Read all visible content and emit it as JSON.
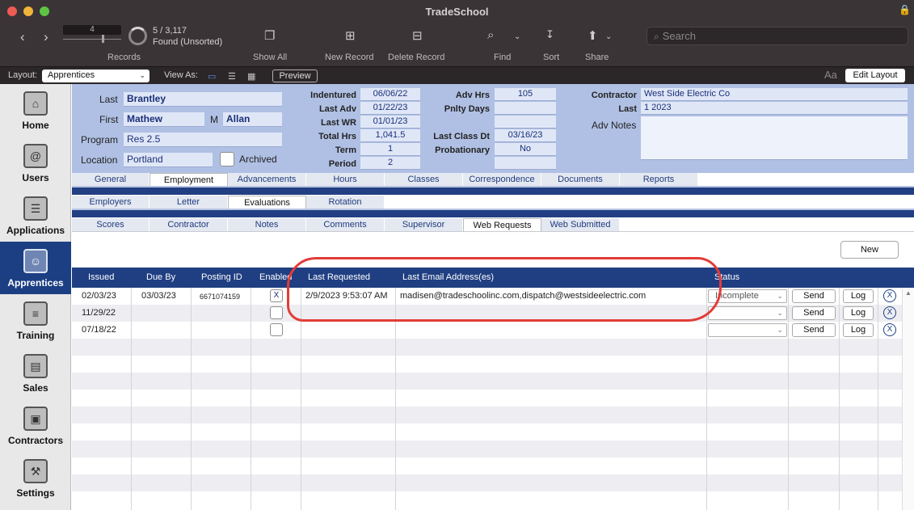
{
  "window": {
    "title": "TradeSchool",
    "colors": {
      "titlebar": "#3a3436",
      "sidebar_active": "#1c3f83",
      "header_bg": "#b0c0e4",
      "stripe": "#223f83",
      "annotation": "#e23c37"
    }
  },
  "toolbar": {
    "record_number": "4",
    "record_count": "5 / 3,117",
    "found_status": "Found (Unsorted)",
    "records_label": "Records",
    "show_all": "Show All",
    "new_record": "New Record",
    "delete_record": "Delete Record",
    "find": "Find",
    "sort": "Sort",
    "share": "Share",
    "search_placeholder": "Search"
  },
  "layoutbar": {
    "layout_label": "Layout:",
    "layout_value": "Apprentices",
    "view_as_label": "View As:",
    "preview": "Preview",
    "aa": "Aa",
    "edit_layout": "Edit Layout"
  },
  "sidebar": {
    "items": [
      {
        "label": "Home",
        "icon": "house-icon"
      },
      {
        "label": "Users",
        "icon": "address-book-icon"
      },
      {
        "label": "Applications",
        "icon": "clipboard-icon"
      },
      {
        "label": "Apprentices",
        "icon": "id-card-icon"
      },
      {
        "label": "Training",
        "icon": "certificate-icon"
      },
      {
        "label": "Sales",
        "icon": "cash-register-icon"
      },
      {
        "label": "Contractors",
        "icon": "briefcase-icon"
      },
      {
        "label": "Settings",
        "icon": "wrench-icon"
      }
    ]
  },
  "header": {
    "last_label": "Last",
    "last_value": "Brantley",
    "first_label": "First",
    "first_value": "Mathew",
    "middle_label": "M",
    "middle_value": "Allan",
    "program_label": "Program",
    "program_value": "Res 2.5",
    "location_label": "Location",
    "location_value": "Portland",
    "archived_label": "Archived",
    "indentured_label": "Indentured",
    "indentured_value": "06/06/22",
    "last_adv_label": "Last Adv",
    "last_adv_value": "01/22/23",
    "last_wr_label": "Last WR",
    "last_wr_value": "01/01/23",
    "total_hrs_label": "Total Hrs",
    "total_hrs_value": "1,041.5",
    "term_label": "Term",
    "term_value": "1",
    "period_label": "Period",
    "period_value": "2",
    "adv_hrs_label": "Adv Hrs",
    "adv_hrs_value": "105",
    "pnlty_days_label": "Pnlty Days",
    "pnlty_days_value": "",
    "last_class_label": "Last Class Dt",
    "last_class_value": "03/16/23",
    "probationary_label": "Probationary",
    "probationary_value": "No",
    "contractor_label": "Contractor",
    "contractor_value": "West Side Electric Co",
    "contractor_last_label": "Last",
    "contractor_last_value": "1 2023",
    "adv_notes_label": "Adv Notes"
  },
  "tabs": {
    "row1": [
      "General",
      "Employment",
      "Advancements",
      "Hours",
      "Classes",
      "Correspondence",
      "Documents",
      "Reports"
    ],
    "row2": [
      "Employers",
      "Letter",
      "Evaluations",
      "Rotation"
    ],
    "row3": [
      "Scores",
      "Contractor",
      "Notes",
      "Comments",
      "Supervisor",
      "Web Requests",
      "Web Submitted"
    ]
  },
  "portal": {
    "new_button": "New",
    "columns": [
      "Issued",
      "Due By",
      "Posting ID",
      "Enabled",
      "Last Requested",
      "Last Email Address(es)",
      "Status"
    ],
    "rows": [
      {
        "issued": "02/03/23",
        "due_by": "03/03/23",
        "posting_id": "6671074159",
        "enabled": "X",
        "last_requested": "2/9/2023 9:53:07 AM",
        "email": "madisen@tradeschoolinc.com,dispatch@westsideelectric.com",
        "status": "Incomplete"
      },
      {
        "issued": "11/29/22",
        "due_by": "",
        "posting_id": "",
        "enabled": "",
        "last_requested": "",
        "email": "",
        "status": ""
      },
      {
        "issued": "07/18/22",
        "due_by": "",
        "posting_id": "",
        "enabled": "",
        "last_requested": "",
        "email": "",
        "status": ""
      }
    ],
    "send": "Send",
    "log": "Log",
    "delete": "X"
  }
}
